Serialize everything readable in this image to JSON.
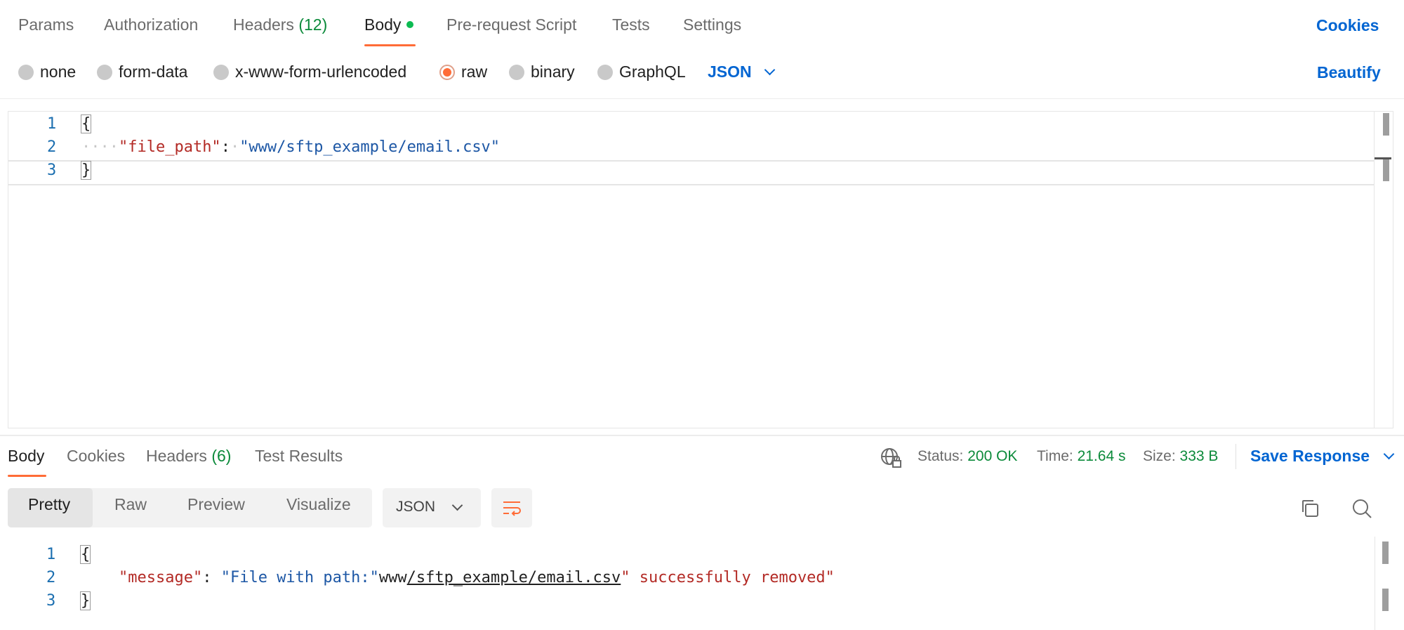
{
  "request_tabs": [
    {
      "label": "Params",
      "active": false
    },
    {
      "label": "Authorization",
      "active": false
    },
    {
      "label": "Headers",
      "count": "(12)",
      "active": false
    },
    {
      "label": "Body",
      "active": true
    },
    {
      "label": "Pre-request Script",
      "active": false
    },
    {
      "label": "Tests",
      "active": false
    },
    {
      "label": "Settings",
      "active": false
    }
  ],
  "cookies_link": "Cookies",
  "body_types": [
    {
      "label": "none",
      "selected": false
    },
    {
      "label": "form-data",
      "selected": false
    },
    {
      "label": "x-www-form-urlencoded",
      "selected": false
    },
    {
      "label": "raw",
      "selected": true
    },
    {
      "label": "binary",
      "selected": false
    },
    {
      "label": "GraphQL",
      "selected": false
    }
  ],
  "raw_format": "JSON",
  "beautify_label": "Beautify",
  "request_editor": {
    "line_numbers": [
      "1",
      "2",
      "3"
    ],
    "open_brace": "{",
    "key": "\"file_path\"",
    "colon": ":",
    "value": "\"www/sftp_example/email.csv\"",
    "close_brace": "}"
  },
  "response_tabs": [
    {
      "label": "Body",
      "active": true
    },
    {
      "label": "Cookies",
      "active": false
    },
    {
      "label": "Headers",
      "count": "(6)",
      "active": false
    },
    {
      "label": "Test Results",
      "active": false
    }
  ],
  "response_meta": {
    "status_label": "Status:",
    "status_value": "200 OK",
    "time_label": "Time:",
    "time_value": "21.64 s",
    "size_label": "Size:",
    "size_value": "333 B"
  },
  "save_response_label": "Save Response",
  "view_modes": [
    "Pretty",
    "Raw",
    "Preview",
    "Visualize"
  ],
  "active_view_mode": "Pretty",
  "response_format": "JSON",
  "response_editor": {
    "line_numbers": [
      "1",
      "2",
      "3"
    ],
    "open_brace": "{",
    "key": "\"message\"",
    "colon": ":",
    "value_part1": "\"File with path:\"",
    "value_plain": "www",
    "value_link": "/sftp_example/email.csv",
    "value_part2": "\" successfully removed\"",
    "close_brace": "}"
  },
  "colors": {
    "accent": "#ff6c37",
    "link": "#0265d2",
    "success": "#0b8a3a"
  },
  "icons": [
    "globe-lock-icon",
    "chevron-down-icon",
    "wrap-lines-icon",
    "copy-icon",
    "search-icon"
  ]
}
